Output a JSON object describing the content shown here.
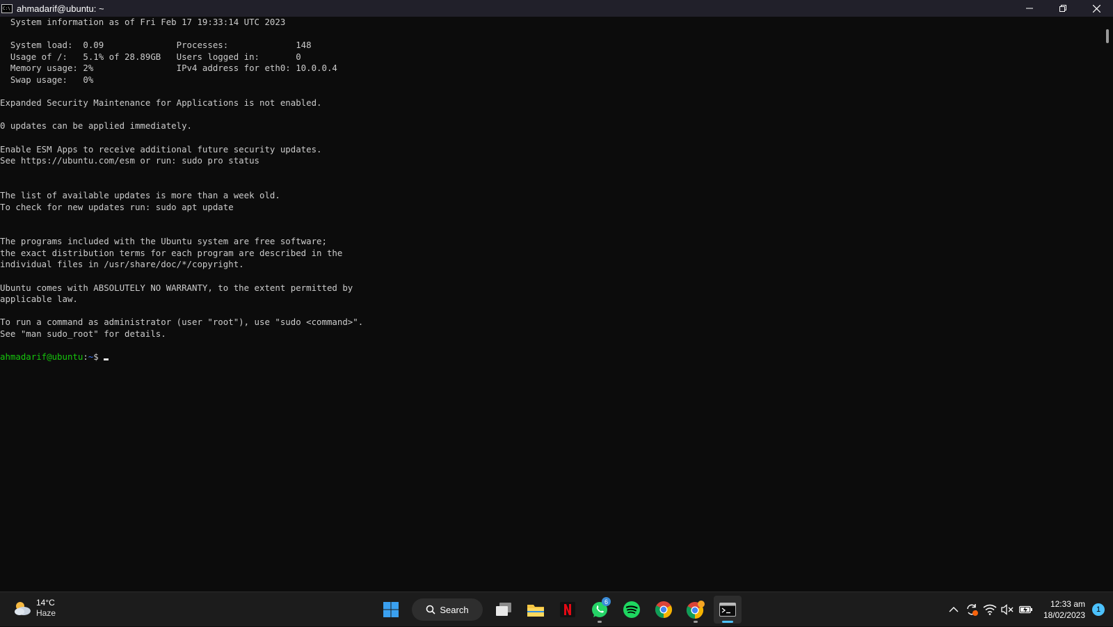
{
  "window": {
    "title": "ahmadarif@ubuntu: ~"
  },
  "terminal": {
    "lines": [
      "  System information as of Fri Feb 17 19:33:14 UTC 2023",
      "",
      "  System load:  0.09              Processes:             148",
      "  Usage of /:   5.1% of 28.89GB   Users logged in:       0",
      "  Memory usage: 2%                IPv4 address for eth0: 10.0.0.4",
      "  Swap usage:   0%",
      "",
      "Expanded Security Maintenance for Applications is not enabled.",
      "",
      "0 updates can be applied immediately.",
      "",
      "Enable ESM Apps to receive additional future security updates.",
      "See https://ubuntu.com/esm or run: sudo pro status",
      "",
      "",
      "The list of available updates is more than a week old.",
      "To check for new updates run: sudo apt update",
      "",
      "",
      "The programs included with the Ubuntu system are free software;",
      "the exact distribution terms for each program are described in the",
      "individual files in /usr/share/doc/*/copyright.",
      "",
      "Ubuntu comes with ABSOLUTELY NO WARRANTY, to the extent permitted by",
      "applicable law.",
      "",
      "To run a command as administrator (user \"root\"), use \"sudo <command>\".",
      "See \"man sudo_root\" for details.",
      ""
    ],
    "prompt_user": "ahmadarif@ubuntu",
    "prompt_sep": ":",
    "prompt_path": "~",
    "prompt_symbol": "$ "
  },
  "taskbar": {
    "weather_temp": "14°C",
    "weather_desc": "Haze",
    "search_label": "Search",
    "whatsapp_badge": "6",
    "clock_time": "12:33 am",
    "clock_date": "18/02/2023",
    "notification_count": "1"
  },
  "colors": {
    "prompt_user": "#16c60c",
    "prompt_path": "#3b78ff",
    "terminal_bg": "#0c0c0c",
    "accent": "#4cc2ff"
  }
}
